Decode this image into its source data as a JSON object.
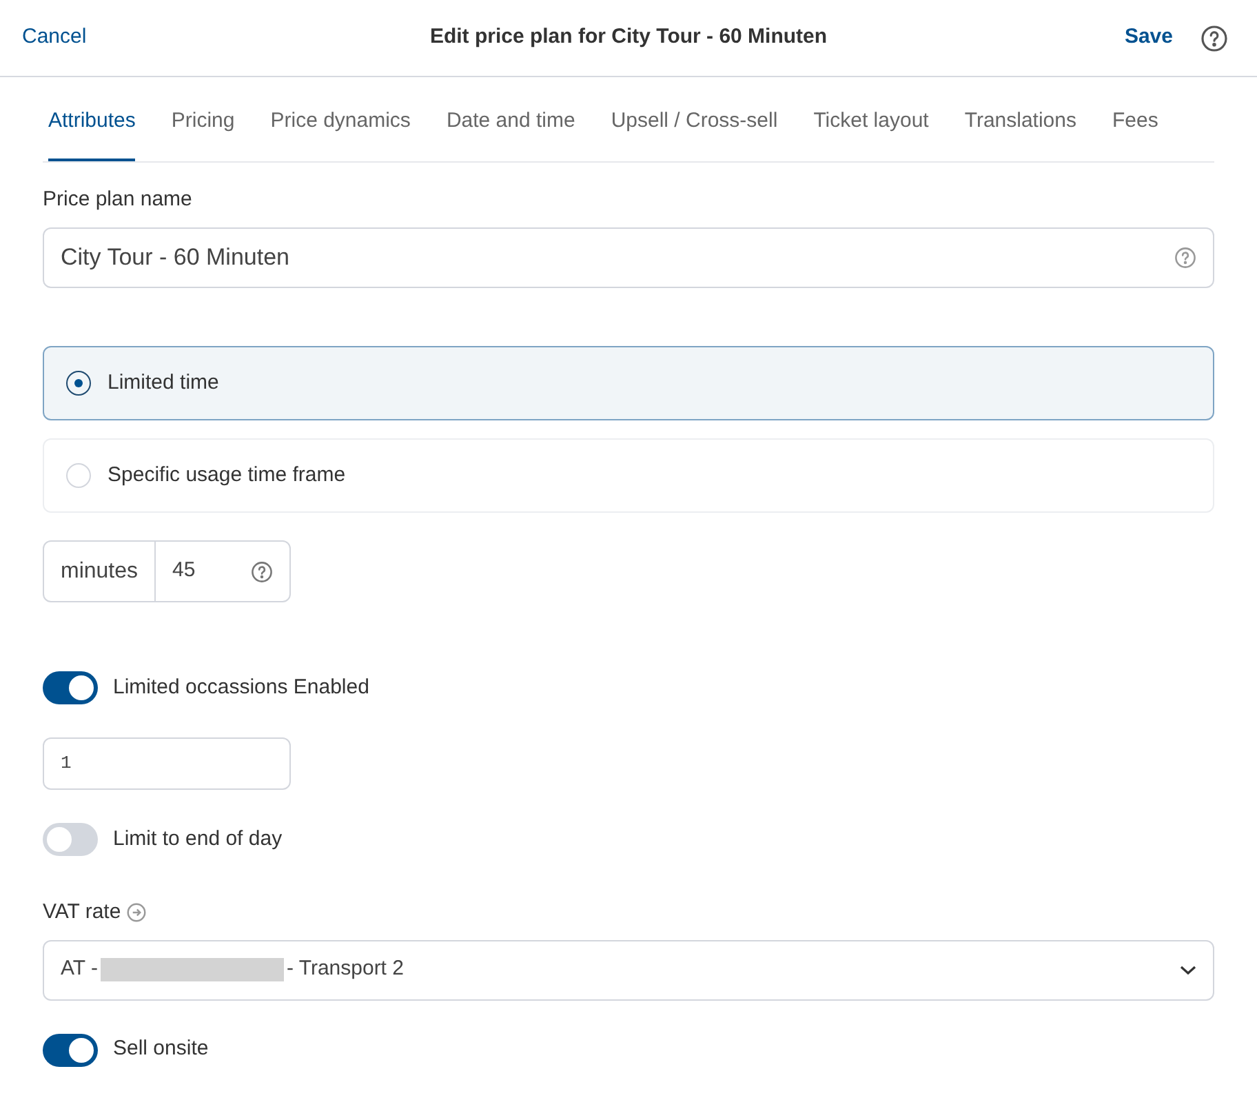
{
  "header": {
    "cancel": "Cancel",
    "title": "Edit price plan for City Tour - 60 Minuten",
    "save": "Save"
  },
  "tabs": [
    {
      "label": "Attributes",
      "selected": true
    },
    {
      "label": "Pricing",
      "selected": false
    },
    {
      "label": "Price dynamics",
      "selected": false
    },
    {
      "label": "Date and time",
      "selected": false
    },
    {
      "label": "Upsell / Cross-sell",
      "selected": false
    },
    {
      "label": "Ticket layout",
      "selected": false
    },
    {
      "label": "Translations",
      "selected": false
    },
    {
      "label": "Fees",
      "selected": false
    }
  ],
  "price_plan_name": {
    "label": "Price plan name",
    "value": "City Tour - 60 Minuten"
  },
  "validity_options": [
    {
      "label": "Limited time",
      "selected": true
    },
    {
      "label": "Specific usage time frame",
      "selected": false
    }
  ],
  "duration": {
    "unit": "minutes",
    "value": "45"
  },
  "limited_occasions": {
    "label": "Limited occassions Enabled",
    "on": true
  },
  "occasions_count": {
    "value": "1"
  },
  "limit_end_of_day": {
    "label": "Limit to end of day",
    "on": false
  },
  "vat_rate": {
    "label": "VAT rate",
    "value_start": "AT -",
    "redacted": true,
    "value_end": "- Transport 2"
  },
  "sell_onsite": {
    "label": "Sell onsite",
    "on": true
  }
}
